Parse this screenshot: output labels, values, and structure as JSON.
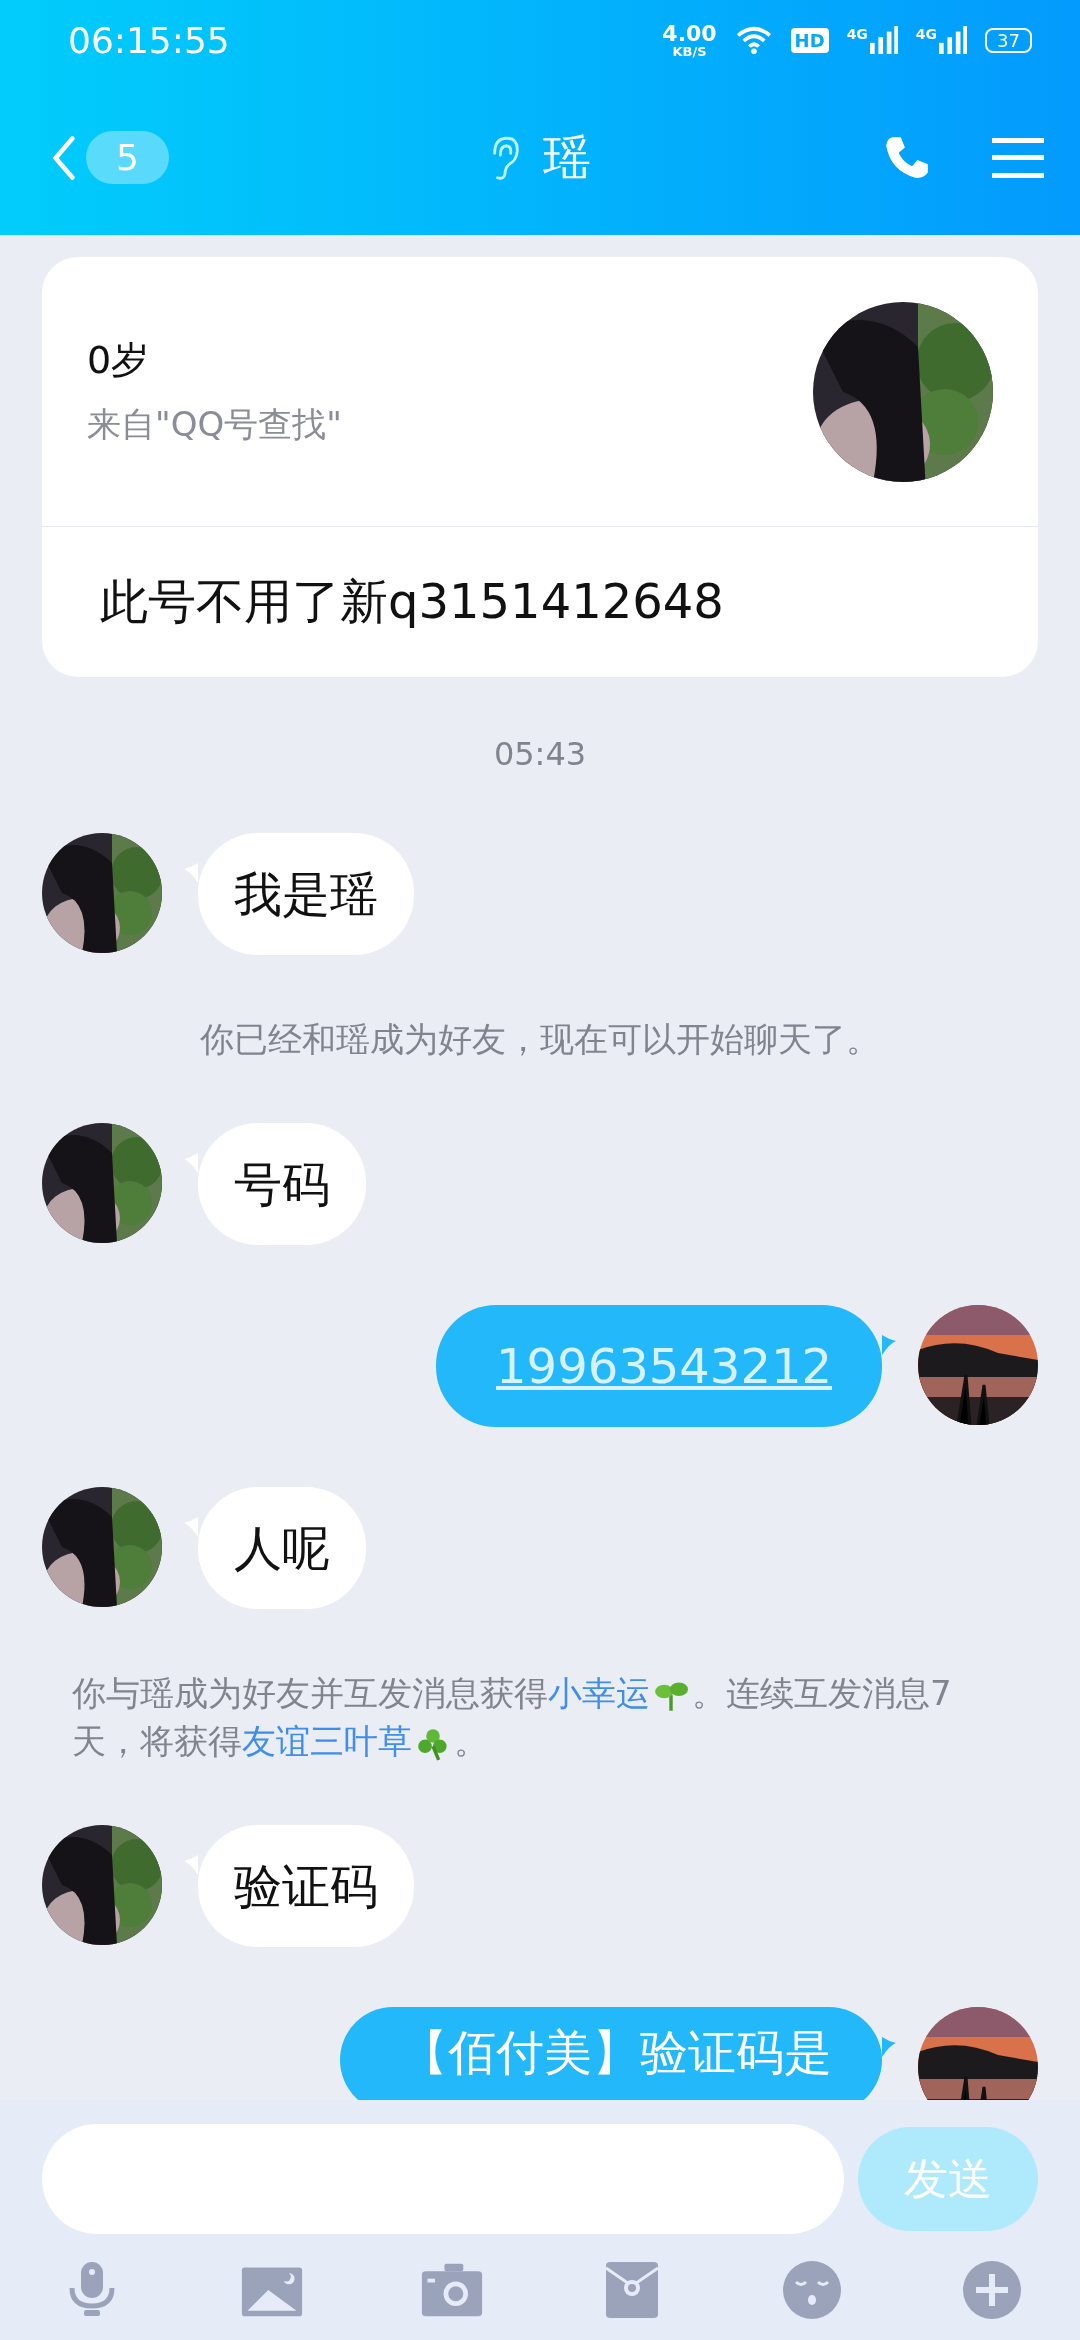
{
  "status_bar": {
    "time": "06:15:55",
    "speed": "4.00",
    "speed_unit": "KB/S",
    "hd": "HD",
    "networks": [
      "4G",
      "4G"
    ],
    "battery": "37"
  },
  "nav": {
    "unread": "5",
    "title": "瑶"
  },
  "profile": {
    "age": "0岁",
    "source": "来自\"QQ号查找\"",
    "signature": "此号不用了新q3151412648"
  },
  "messages": [
    {
      "kind": "time",
      "text": "05:43"
    },
    {
      "kind": "received",
      "text": "我是瑶"
    },
    {
      "kind": "system",
      "text": "你已经和瑶成为好友，现在可以开始聊天了。"
    },
    {
      "kind": "received",
      "text": "号码"
    },
    {
      "kind": "sent",
      "text": "19963543212",
      "link": true
    },
    {
      "kind": "received",
      "text": "人呢"
    },
    {
      "kind": "system_rich",
      "parts": [
        {
          "kind": "text",
          "text": "你与瑶成为好友并互发消息获得"
        },
        {
          "kind": "link",
          "text": "小幸运"
        },
        {
          "kind": "sprout"
        },
        {
          "kind": "text",
          "text": "。连续互发消息7天，将获得"
        },
        {
          "kind": "link",
          "text": "友谊三叶草"
        },
        {
          "kind": "clover"
        },
        {
          "kind": "text",
          "text": "。"
        }
      ]
    },
    {
      "kind": "received",
      "text": "验证码"
    },
    {
      "kind": "sent",
      "text": "【佰付美】验证码是",
      "link": false
    }
  ],
  "composer": {
    "send": "发送",
    "send_disabled": true
  }
}
